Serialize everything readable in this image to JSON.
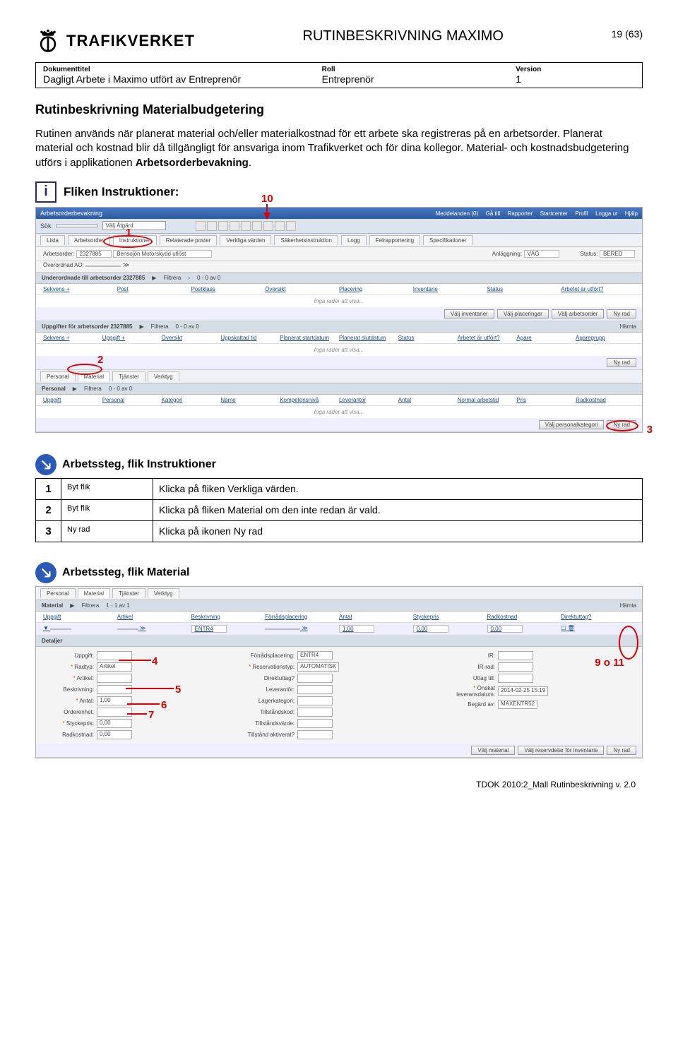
{
  "header": {
    "brand": "TRAFIKVERKET",
    "doc_title": "RUTINBESKRIVNING MAXIMO",
    "page_num": "19 (63)"
  },
  "meta": {
    "label_doctitle": "Dokumenttitel",
    "doctitle": "Dagligt Arbete i Maximo utfört av Entreprenör",
    "label_role": "Roll",
    "role": "Entreprenör",
    "label_version": "Version",
    "version": "1"
  },
  "section1": {
    "title": "Rutinbeskrivning Materialbudgetering",
    "body": "Rutinen används när planerat material och/eller materialkostnad för ett arbete ska registreras på en arbetsorder. Planerat material och kostnad blir då tillgängligt för ansvariga inom Trafikverket och för dina kollegor. Material- och kostnadsbudgetering utförs i applikationen ",
    "body_bold": "Arbetsorderbevakning"
  },
  "info": {
    "title": "Fliken Instruktioner:"
  },
  "callouts": {
    "c1": "1",
    "c2": "2",
    "c3": "3",
    "c10": "10",
    "c4": "4",
    "c5": "5",
    "c6": "6",
    "c7": "7",
    "c9o11": "9 o 11"
  },
  "maximo1": {
    "app_title": "Arbetsorderbevakning",
    "topright": [
      "Meddelanden (0)",
      "Gå till",
      "Rapporter",
      "Startcenter",
      "Profil",
      "Logga ut",
      "Hjälp"
    ],
    "search_label": "Sök",
    "dropdown": "Välj Åtgärd",
    "tabs": [
      "Lista",
      "Arbetsorder",
      "Instruktioner",
      "Relaterade poster",
      "Verkliga värden",
      "Säkerhetsinstruktion",
      "Logg",
      "Felrapportering",
      "Specifikationer"
    ],
    "fields": {
      "ao_label": "Arbetsorder:",
      "ao_val": "2327885",
      "ao_desc": "Bensojön Motorskydd utlöst",
      "over_label": "Överordnad AO:",
      "anl_label": "Anläggning:",
      "anl_val": "VÄG",
      "stat_label": "Status:",
      "stat_val": "BERED"
    },
    "sec1": {
      "title": "Underordnade till arbetsorder 2327885",
      "filter": "Filtrera",
      "range": "0 - 0 av 0",
      "cols": [
        "Sekvens +",
        "Post",
        "Postklass",
        "Översikt",
        "Placering",
        "Inventarie",
        "Status",
        "Arbetet är utfört?"
      ],
      "empty": "Inga rader att visa...",
      "buttons": [
        "Välj inventarier",
        "Välj placeringar",
        "Välj arbetsorder",
        "Ny rad"
      ]
    },
    "sec2": {
      "title": "Uppgifter för arbetsorder 2327885",
      "filter": "Filtrera",
      "range": "0 - 0 av 0",
      "btn": "Hämta",
      "cols": [
        "Sekvens +",
        "Uppgift +",
        "Översikt",
        "Uppskattad tid",
        "Planerat startdatum",
        "Planerat slutdatum",
        "Status",
        "Arbetet är utfört?",
        "Ägare",
        "Ägaregrupp"
      ],
      "empty": "Inga rader att visa...",
      "buttons": [
        "Ny rad"
      ]
    },
    "subtabs": [
      "Personal",
      "Material",
      "Tjänster",
      "Verktyg"
    ],
    "sec3": {
      "title": "Personal",
      "filter": "Filtrera",
      "range": "0 - 0 av 0",
      "cols": [
        "Uppgift",
        "Personal",
        "Kategori",
        "Name",
        "Kompetensnivå",
        "Leverantör",
        "Antal",
        "Normal arbetstid",
        "Pris",
        "Radkostnad"
      ],
      "empty": "Inga rader att visa...",
      "buttons": [
        "Välj personalkategori",
        "Ny rad"
      ]
    }
  },
  "steps1": {
    "title": "Arbetssteg, flik Instruktioner",
    "rows": [
      {
        "n": "1",
        "act": "Byt flik",
        "desc": "Klicka på fliken Verkliga värden."
      },
      {
        "n": "2",
        "act": "Byt flik",
        "desc": "Klicka på fliken Material om den inte redan är vald."
      },
      {
        "n": "3",
        "act": "Ny rad",
        "desc": "Klicka på ikonen Ny rad"
      }
    ]
  },
  "steps2": {
    "title": "Arbetssteg, flik Material"
  },
  "maximo2": {
    "subtabs": [
      "Personal",
      "Material",
      "Tjänster",
      "Verktyg"
    ],
    "sec": {
      "title": "Material",
      "filter": "Filtrera",
      "range": "1 - 1 av 1",
      "btn": "Hämta",
      "cols": [
        "Uppgift",
        "Artikel",
        "Beskrivning",
        "Förrådsplacering",
        "Antal",
        "Styckepris",
        "Radkostnad",
        "Direktuttag?"
      ],
      "row": {
        "besk": "ENTR4",
        "antal": "1,00",
        "pris": "0,00",
        "kost": "0,00"
      },
      "buttons": [
        "Välj material",
        "Välj reservdelar för inventarie",
        "Ny rad"
      ]
    },
    "details": {
      "title": "Detaljer",
      "col1": [
        {
          "l": "Uppgift:",
          "v": ""
        },
        {
          "l": "Radtyp:",
          "v": "Artikel",
          "star": true
        },
        {
          "l": "Artikel:",
          "v": "",
          "star": true
        },
        {
          "l": "Beskrivning:",
          "v": ""
        },
        {
          "l": "Antal:",
          "v": "1,00",
          "star": true
        },
        {
          "l": "Orderenhet:",
          "v": ""
        },
        {
          "l": "Styckepris:",
          "v": "0,00",
          "star": true
        },
        {
          "l": "Radkostnad:",
          "v": "0,00"
        }
      ],
      "col2": [
        {
          "l": "Förrådsplacering:",
          "v": "ENTR4"
        },
        {
          "l": "Reservationstyp:",
          "v": "AUTOMATISK",
          "star": true
        },
        {
          "l": "Direktuttag?",
          "v": ""
        },
        {
          "l": "Leverantör:",
          "v": ""
        },
        {
          "l": "Lagerkategori:",
          "v": ""
        },
        {
          "l": "Tillståndskod:",
          "v": ""
        },
        {
          "l": "Tillståndsvärde:",
          "v": ""
        },
        {
          "l": "Tillstånd aktiverat?",
          "v": ""
        }
      ],
      "col3": [
        {
          "l": "IR:",
          "v": ""
        },
        {
          "l": "IR-rad:",
          "v": ""
        },
        {
          "l": "Uttag till:",
          "v": ""
        },
        {
          "l": "Önskat leveransdatum:",
          "v": "2014-02-25 15:19",
          "star": true
        },
        {
          "l": "Begärd av:",
          "v": "MAXENTR52"
        }
      ]
    }
  },
  "footer": "TDOK 2010:2_Mall Rutinbeskrivning v. 2.0"
}
